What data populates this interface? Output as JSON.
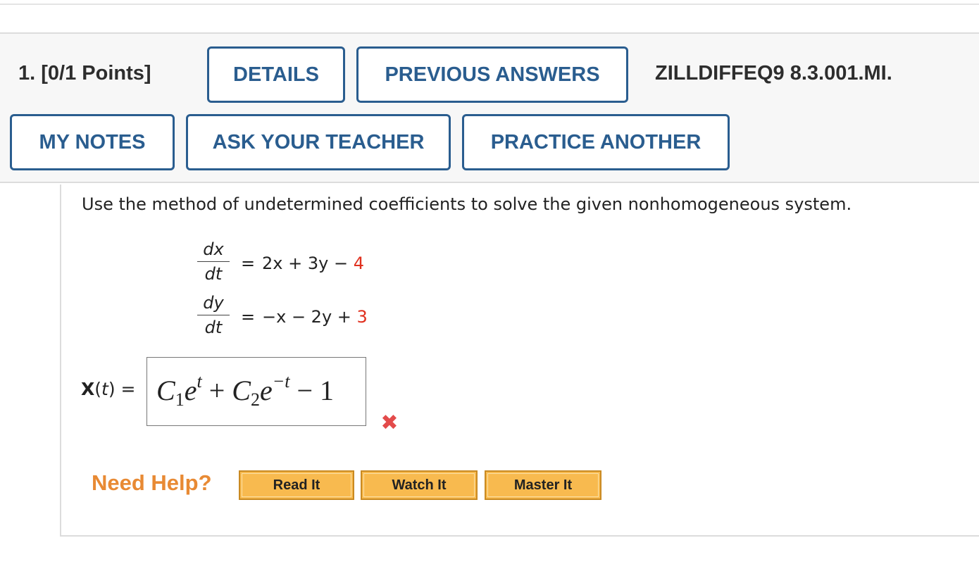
{
  "question": {
    "number_label": "1. [0/1 Points]",
    "code": "ZILLDIFFEQ9 8.3.001.MI."
  },
  "header_buttons": {
    "details": "DETAILS",
    "previous_answers": "PREVIOUS ANSWERS",
    "my_notes": "MY NOTES",
    "ask_teacher": "ASK YOUR TEACHER",
    "practice_another": "PRACTICE ANOTHER"
  },
  "problem": {
    "prompt": "Use the method of undetermined coefficients to solve the given nonhomogeneous system.",
    "eq1": {
      "num": "dx",
      "den": "dt",
      "equals": "=",
      "rhs": "2x + 3y −",
      "const": "4"
    },
    "eq2": {
      "num": "dy",
      "den": "dt",
      "equals": "=",
      "rhs": "−x − 2y +",
      "const": "3"
    },
    "answer_label": "X(t) =",
    "answer": {
      "c1": "C",
      "c1_sub": "1",
      "e1": "e",
      "e1_sup": "t",
      "plus": " + ",
      "c2": "C",
      "c2_sub": "2",
      "e2": "e",
      "e2_sup": "−t",
      "minus": " − ",
      "const": "1"
    },
    "status_icon": "wrong-x-icon",
    "status_color": "#e34b4b"
  },
  "help": {
    "label": "Need Help?",
    "read_it": "Read It",
    "watch_it": "Watch It",
    "master_it": "Master It",
    "label_color": "#e88a34",
    "button_color": "#f8ba4f"
  },
  "colors": {
    "button_border": "#2a5d8f",
    "constant_red": "#e0301e"
  }
}
